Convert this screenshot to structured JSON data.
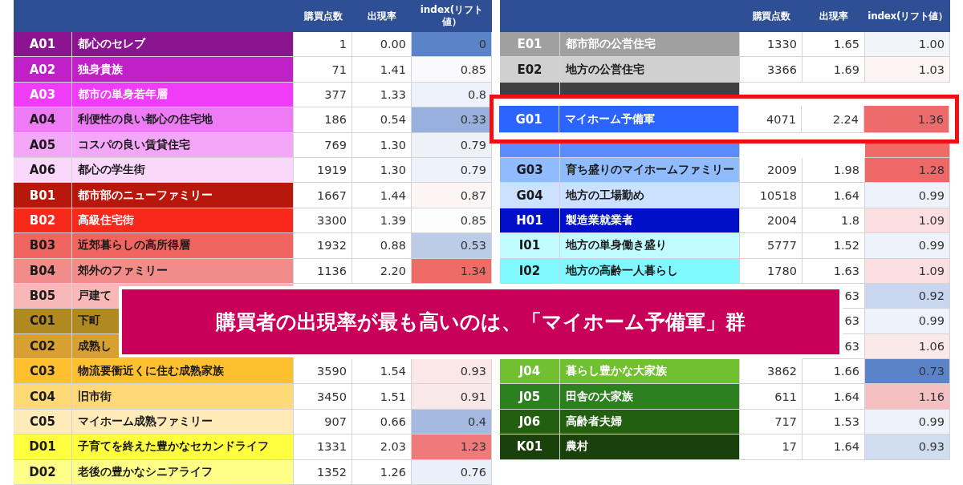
{
  "left_table": {
    "columns": [
      "購買点数",
      "出現率",
      "index(リフト値）"
    ],
    "rows": [
      {
        "code": "A01",
        "name": "都心のセレブ",
        "color": "#8b1591",
        "light_text": true,
        "count": "1",
        "rate": "0.00",
        "index": {
          "text": "0",
          "color": "#5b84c8"
        }
      },
      {
        "code": "A02",
        "name": "独身貴族",
        "color": "#c020c8",
        "light_text": true,
        "count": "71",
        "rate": "1.41",
        "index": {
          "text": "0.85",
          "color": "#fafafc"
        }
      },
      {
        "code": "A03",
        "name": "都市の単身若年層",
        "color": "#f03cf8",
        "light_text": true,
        "count": "377",
        "rate": "1.33",
        "index": {
          "text": "0.8",
          "color": "#eef2fa"
        }
      },
      {
        "code": "A04",
        "name": "利便性の良い都心の住宅地",
        "color": "#ee7af5",
        "light_text": false,
        "count": "186",
        "rate": "0.54",
        "index": {
          "text": "0.33",
          "color": "#98b0de"
        }
      },
      {
        "code": "A05",
        "name": "コスパの良い賃貸住宅",
        "color": "#f4a6f8",
        "light_text": false,
        "count": "769",
        "rate": "1.30",
        "index": {
          "text": "0.79",
          "color": "#eef2f8"
        }
      },
      {
        "code": "A06",
        "name": "都心の学生街",
        "color": "#fad8fc",
        "light_text": false,
        "count": "1919",
        "rate": "1.30",
        "index": {
          "text": "0.79",
          "color": "#eef2fa"
        }
      },
      {
        "code": "B01",
        "name": "都市部のニューファミリー",
        "color": "#b8180c",
        "light_text": true,
        "count": "1667",
        "rate": "1.44",
        "index": {
          "text": "0.87",
          "color": "#fdf5f5"
        }
      },
      {
        "code": "B02",
        "name": "高級住宅街",
        "color": "#f8291a",
        "light_text": true,
        "count": "3300",
        "rate": "1.39",
        "index": {
          "text": "0.85",
          "color": "#fdfdfd"
        }
      },
      {
        "code": "B03",
        "name": "近郊暮らしの高所得層",
        "color": "#f06560",
        "light_text": false,
        "count": "1932",
        "rate": "0.88",
        "index": {
          "text": "0.53",
          "color": "#bccbe8"
        }
      },
      {
        "code": "B04",
        "name": "郊外のファミリー",
        "color": "#f28c8a",
        "light_text": false,
        "count": "1136",
        "rate": "2.20",
        "index": {
          "text": "1.34",
          "color": "#ee6b66"
        }
      },
      {
        "code": "B05",
        "name": "戸建て",
        "color": "#f8b8b8",
        "light_text": false
      },
      {
        "code": "C01",
        "name": "下町",
        "color": "#b08a20",
        "light_text": false
      },
      {
        "code": "C02",
        "name": "成熟し",
        "color": "#d8a030",
        "light_text": false
      },
      {
        "code": "C03",
        "name": "物流要衝近くに住む成熟家族",
        "color": "#ffc030",
        "light_text": false,
        "count": "3590",
        "rate": "1.54",
        "index": {
          "text": "0.93",
          "color": "#fbe7e8"
        }
      },
      {
        "code": "C04",
        "name": "旧市街",
        "color": "#ffd878",
        "light_text": false,
        "count": "3450",
        "rate": "1.51",
        "index": {
          "text": "0.91",
          "color": "#f9e8ea"
        }
      },
      {
        "code": "C05",
        "name": "マイホーム成熟ファミリー",
        "color": "#ffeab8",
        "light_text": false,
        "count": "907",
        "rate": "0.66",
        "index": {
          "text": "0.4",
          "color": "#a6b9e0"
        }
      },
      {
        "code": "D01",
        "name": "子育てを終えた豊かなセカンドライフ",
        "color": "#ffff40",
        "light_text": false,
        "count": "1331",
        "rate": "2.03",
        "index": {
          "text": "1.23",
          "color": "#f07a7a"
        }
      },
      {
        "code": "D02",
        "name": "老後の豊かなシニアライフ",
        "color": "#ffff88",
        "light_text": false,
        "count": "1352",
        "rate": "1.26",
        "index": {
          "text": "0.76",
          "color": "#eaf0fa"
        }
      }
    ]
  },
  "right_table": {
    "columns": [
      "購買点数",
      "出現率",
      "index(リフト値）"
    ],
    "rows": [
      {
        "code": "E01",
        "name": "都市部の公営住宅",
        "color": "#a0a0a0",
        "light_text": true,
        "count": "1330",
        "rate": "1.65",
        "index": {
          "text": "1.00",
          "color": "#f2f4fa"
        }
      },
      {
        "code": "E02",
        "name": "地方の公営住宅",
        "color": "#d0d0d0",
        "light_text": false,
        "count": "3366",
        "rate": "1.69",
        "index": {
          "text": "1.03",
          "color": "#fcf4f5"
        }
      },
      {
        "color": "#404040"
      },
      {},
      {
        "color": "#5b8cff",
        "index": {
          "color": "#ee6b66"
        }
      },
      {
        "code": "G03",
        "name": "育ち盛りのマイホームファミリー",
        "color": "#90bbff",
        "light_text": false,
        "count": "2009",
        "rate": "1.98",
        "index": {
          "text": "1.28",
          "color": "#ee6868"
        }
      },
      {
        "code": "G04",
        "name": "地方の工場勤め",
        "color": "#cce0ff",
        "light_text": false,
        "count": "10518",
        "rate": "1.64",
        "index": {
          "text": "0.99",
          "color": "#eef2fa"
        }
      },
      {
        "code": "H01",
        "name": "製造業就業者",
        "color": "#0010c8",
        "light_text": true,
        "count": "2004",
        "rate": "1.8",
        "index": {
          "text": "1.09",
          "color": "#fbdfe0"
        }
      },
      {
        "code": "I01",
        "name": "地方の単身働き盛り",
        "color": "#c0fbff",
        "light_text": false,
        "count": "5777",
        "rate": "1.52",
        "index": {
          "text": "0.99",
          "color": "#eef2fa"
        }
      },
      {
        "code": "I02",
        "name": "地方の高齢一人暮らし",
        "color": "#80f8ff",
        "light_text": false,
        "count": "1780",
        "rate": "1.63",
        "index": {
          "text": "1.09",
          "color": "#fbdfe0"
        }
      },
      {
        "rate": "63",
        "index": {
          "text": "0.92",
          "color": "#c8d6f0"
        }
      },
      {
        "rate": "63",
        "index": {
          "text": "0.99",
          "color": "#eef2fa"
        }
      },
      {
        "rate": "63",
        "index": {
          "text": "1.06",
          "color": "#fbe8e8"
        }
      },
      {
        "code": "J04",
        "name": "暮らし豊かな大家族",
        "color": "#70c030",
        "light_text": true,
        "count": "3862",
        "rate": "1.66",
        "index": {
          "text": "0.73",
          "color": "#5b84c8"
        }
      },
      {
        "code": "J05",
        "name": "田舎の大家族",
        "color": "#2d8020",
        "light_text": true,
        "count": "611",
        "rate": "1.64",
        "index": {
          "text": "1.16",
          "color": "#f4c0c2"
        }
      },
      {
        "code": "J06",
        "name": "高齢者夫婦",
        "color": "#226010",
        "light_text": true,
        "count": "717",
        "rate": "1.53",
        "index": {
          "text": "0.99",
          "color": "#eef2fa"
        }
      },
      {
        "code": "K01",
        "name": "農村",
        "color": "#1a400c",
        "light_text": true,
        "count": "17",
        "rate": "1.64",
        "index": {
          "text": "0.93",
          "color": "#d0dcf0"
        }
      }
    ]
  },
  "highlight": {
    "code": "G01",
    "name": "マイホーム予備軍",
    "color": "#2c64ff",
    "light_text": true,
    "count": "4071",
    "rate": "2.24",
    "index": {
      "text": "1.36",
      "color": "#ee6b6b"
    }
  },
  "banner": {
    "text": "購買者の出現率が最も高いのは、「マイホーム予備軍」群"
  }
}
